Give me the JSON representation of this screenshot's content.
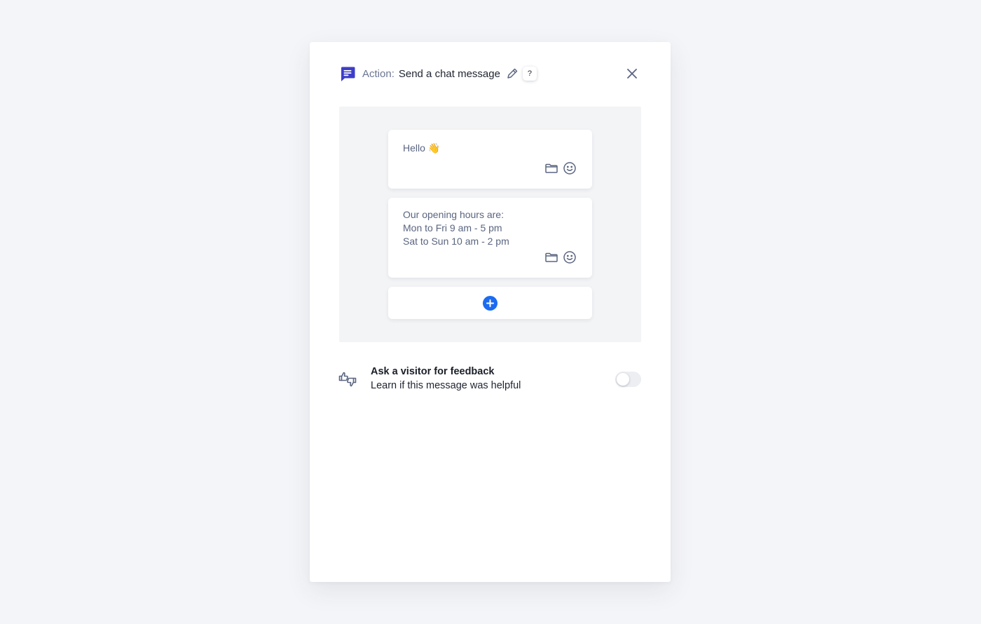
{
  "header": {
    "action_label": "Action:",
    "action_name": "Send a chat message",
    "help_label": "?",
    "chat_icon": "chat-message-icon",
    "edit_icon": "pencil-icon",
    "close_icon": "close-icon"
  },
  "messages": [
    {
      "text": "Hello 👋",
      "tools": [
        "folder-icon",
        "emoji-icon"
      ]
    },
    {
      "text": "Our opening hours are:\nMon to Fri 9 am - 5 pm\nSat to Sun 10 am - 2 pm",
      "tools": [
        "folder-icon",
        "emoji-icon"
      ]
    }
  ],
  "add_message": {
    "icon": "plus-icon"
  },
  "feedback": {
    "title": "Ask a visitor for feedback",
    "subtitle": "Learn if this message was helpful",
    "icon": "thumbs-up-down-icon",
    "enabled": false
  },
  "colors": {
    "accent": "#1c6bf1",
    "chat_icon": "#3d3ec8",
    "page_background": "#f4f5f8",
    "messages_area": "#f3f4f6",
    "muted_text": "#6b7691"
  }
}
